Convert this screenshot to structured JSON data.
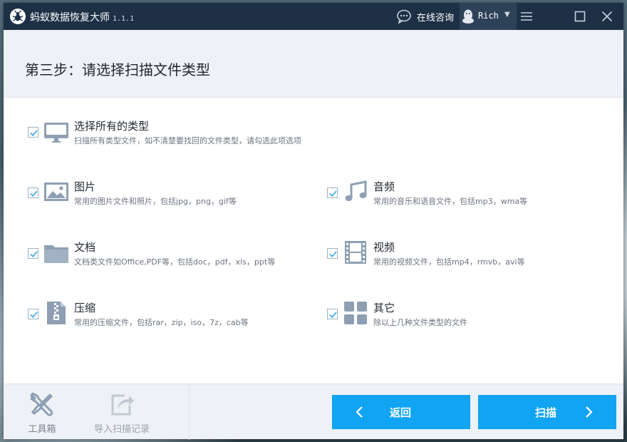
{
  "app": {
    "title": "蚂蚁数据恢复大师",
    "version": "1.1.1"
  },
  "titlebar": {
    "consult_label": "在线咨询",
    "user_name": "Rich",
    "user_caret": "▼"
  },
  "step": {
    "title": "第三步：请选择扫描文件类型"
  },
  "file_types": [
    {
      "label": "选择所有的类型",
      "desc": "扫描所有类型文件，如不清楚要找回的文件类型，请勾选此项选项",
      "checked": true,
      "icon": "monitor-icon"
    },
    {
      "label": "图片",
      "desc": "常用的图片文件和照片，包括jpg，png，gif等",
      "checked": true,
      "icon": "image-icon"
    },
    {
      "label": "音频",
      "desc": "常用的音乐和语音文件，包括mp3，wma等",
      "checked": true,
      "icon": "music-note-icon"
    },
    {
      "label": "文档",
      "desc": "文档类文件如Office,PDF等，包括doc，pdf，xls，ppt等",
      "checked": true,
      "icon": "folder-icon"
    },
    {
      "label": "视频",
      "desc": "常用的视频文件，包括mp4，rmvb，avi等",
      "checked": true,
      "icon": "film-icon"
    },
    {
      "label": "压缩",
      "desc": "常用的压缩文件，包括rar，zip，iso，7z，cab等",
      "checked": true,
      "icon": "zip-file-icon"
    },
    {
      "label": "其它",
      "desc": "除以上几种文件类型的文件",
      "checked": true,
      "icon": "grid-icon"
    }
  ],
  "footer": {
    "toolbox_label": "工具箱",
    "import_label": "导入扫描记录",
    "back_label": "返回",
    "scan_label": "扫描"
  },
  "colors": {
    "titlebar": "#1d3046",
    "accent": "#11a4f2",
    "header_bg": "#eef1f6",
    "icon_gray": "#8e9fb3"
  }
}
